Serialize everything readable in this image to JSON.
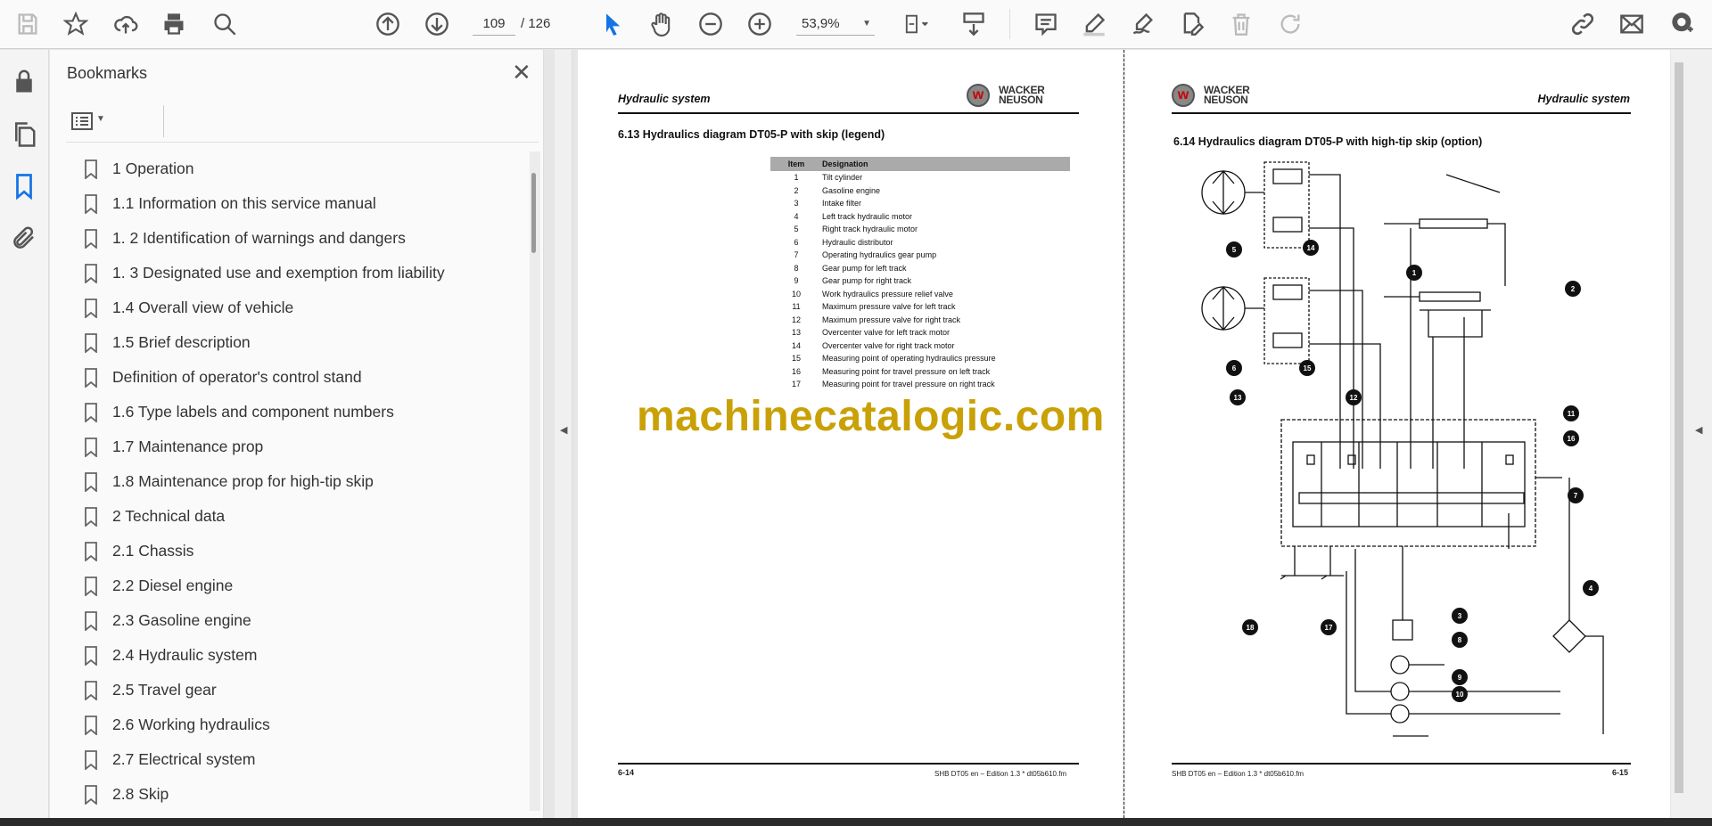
{
  "toolbar": {
    "icons": [
      "save-icon",
      "bookmark-star-icon",
      "upload-cloud-icon",
      "print-icon",
      "search-zoom-icon",
      "page-up-icon",
      "page-down-icon",
      "select-cursor-icon",
      "hand-pan-icon",
      "zoom-out-icon",
      "zoom-in-icon",
      "fit-page-icon",
      "scroll-mode-icon",
      "comment-icon",
      "highlight-pen-icon",
      "sign-icon",
      "edit-text-icon",
      "delete-icon",
      "rotate-icon",
      "share-link-icon",
      "email-icon",
      "account-icon"
    ],
    "current_page": "109",
    "page_separator": "/ 126",
    "zoom": "53,9%",
    "accent": "#1473e6"
  },
  "rail": {
    "icons": [
      "lock-icon",
      "pages-icon",
      "bookmark-icon",
      "attachment-icon"
    ]
  },
  "bookmarks": {
    "title": "Bookmarks",
    "items": [
      "1 Operation",
      "1.1 Information on this service manual",
      "1. 2 Identification of warnings and dangers",
      "1. 3 Designated use and exemption from liability",
      "1.4 Overall view of vehicle",
      "1.5 Brief description",
      "Definition of operator's control stand",
      "1.6 Type labels and component numbers",
      "1.7 Maintenance prop",
      "1.8 Maintenance prop for high-tip skip",
      "2 Technical data",
      "2.1 Chassis",
      "2.2 Diesel engine",
      "2.3 Gasoline engine",
      "2.4 Hydraulic system",
      "2.5 Travel gear",
      "2.6 Working hydraulics",
      "2.7 Electrical system",
      "2.8 Skip"
    ]
  },
  "page_left": {
    "header": "Hydraulic system",
    "logo": "WACKER NEUSON",
    "section": "6.13   Hydraulics diagram DT05-P with skip (legend)",
    "legend_headers": [
      "Item",
      "Designation"
    ],
    "legend": [
      [
        "1",
        "Tilt cylinder"
      ],
      [
        "2",
        "Gasoline engine"
      ],
      [
        "3",
        "Intake filter"
      ],
      [
        "4",
        "Left track hydraulic motor"
      ],
      [
        "5",
        "Right track hydraulic motor"
      ],
      [
        "6",
        "Hydraulic distributor"
      ],
      [
        "7",
        "Operating hydraulics gear pump"
      ],
      [
        "8",
        "Gear pump for left track"
      ],
      [
        "9",
        "Gear pump for right track"
      ],
      [
        "10",
        "Work hydraulics pressure relief valve"
      ],
      [
        "11",
        "Maximum pressure valve for left track"
      ],
      [
        "12",
        "Maximum pressure valve for right track"
      ],
      [
        "13",
        "Overcenter valve for left track motor"
      ],
      [
        "14",
        "Overcenter valve for right track motor"
      ],
      [
        "15",
        "Measuring point of operating hydraulics pressure"
      ],
      [
        "16",
        "Measuring point for travel pressure on left track"
      ],
      [
        "17",
        "Measuring point for travel pressure on right track"
      ]
    ],
    "page_number": "6-14",
    "footer": "SHB DT05 en – Edition 1.3 * dt05b610.fm"
  },
  "page_right": {
    "header": "Hydraulic system",
    "logo": "WACKER NEUSON",
    "section": "6.14 Hydraulics diagram DT05-P with high-tip skip (option)",
    "page_number": "6-15",
    "footer": "SHB DT05 en – Edition 1.3 * dt05b610.fm"
  },
  "watermark": "machinecatalogic.com"
}
